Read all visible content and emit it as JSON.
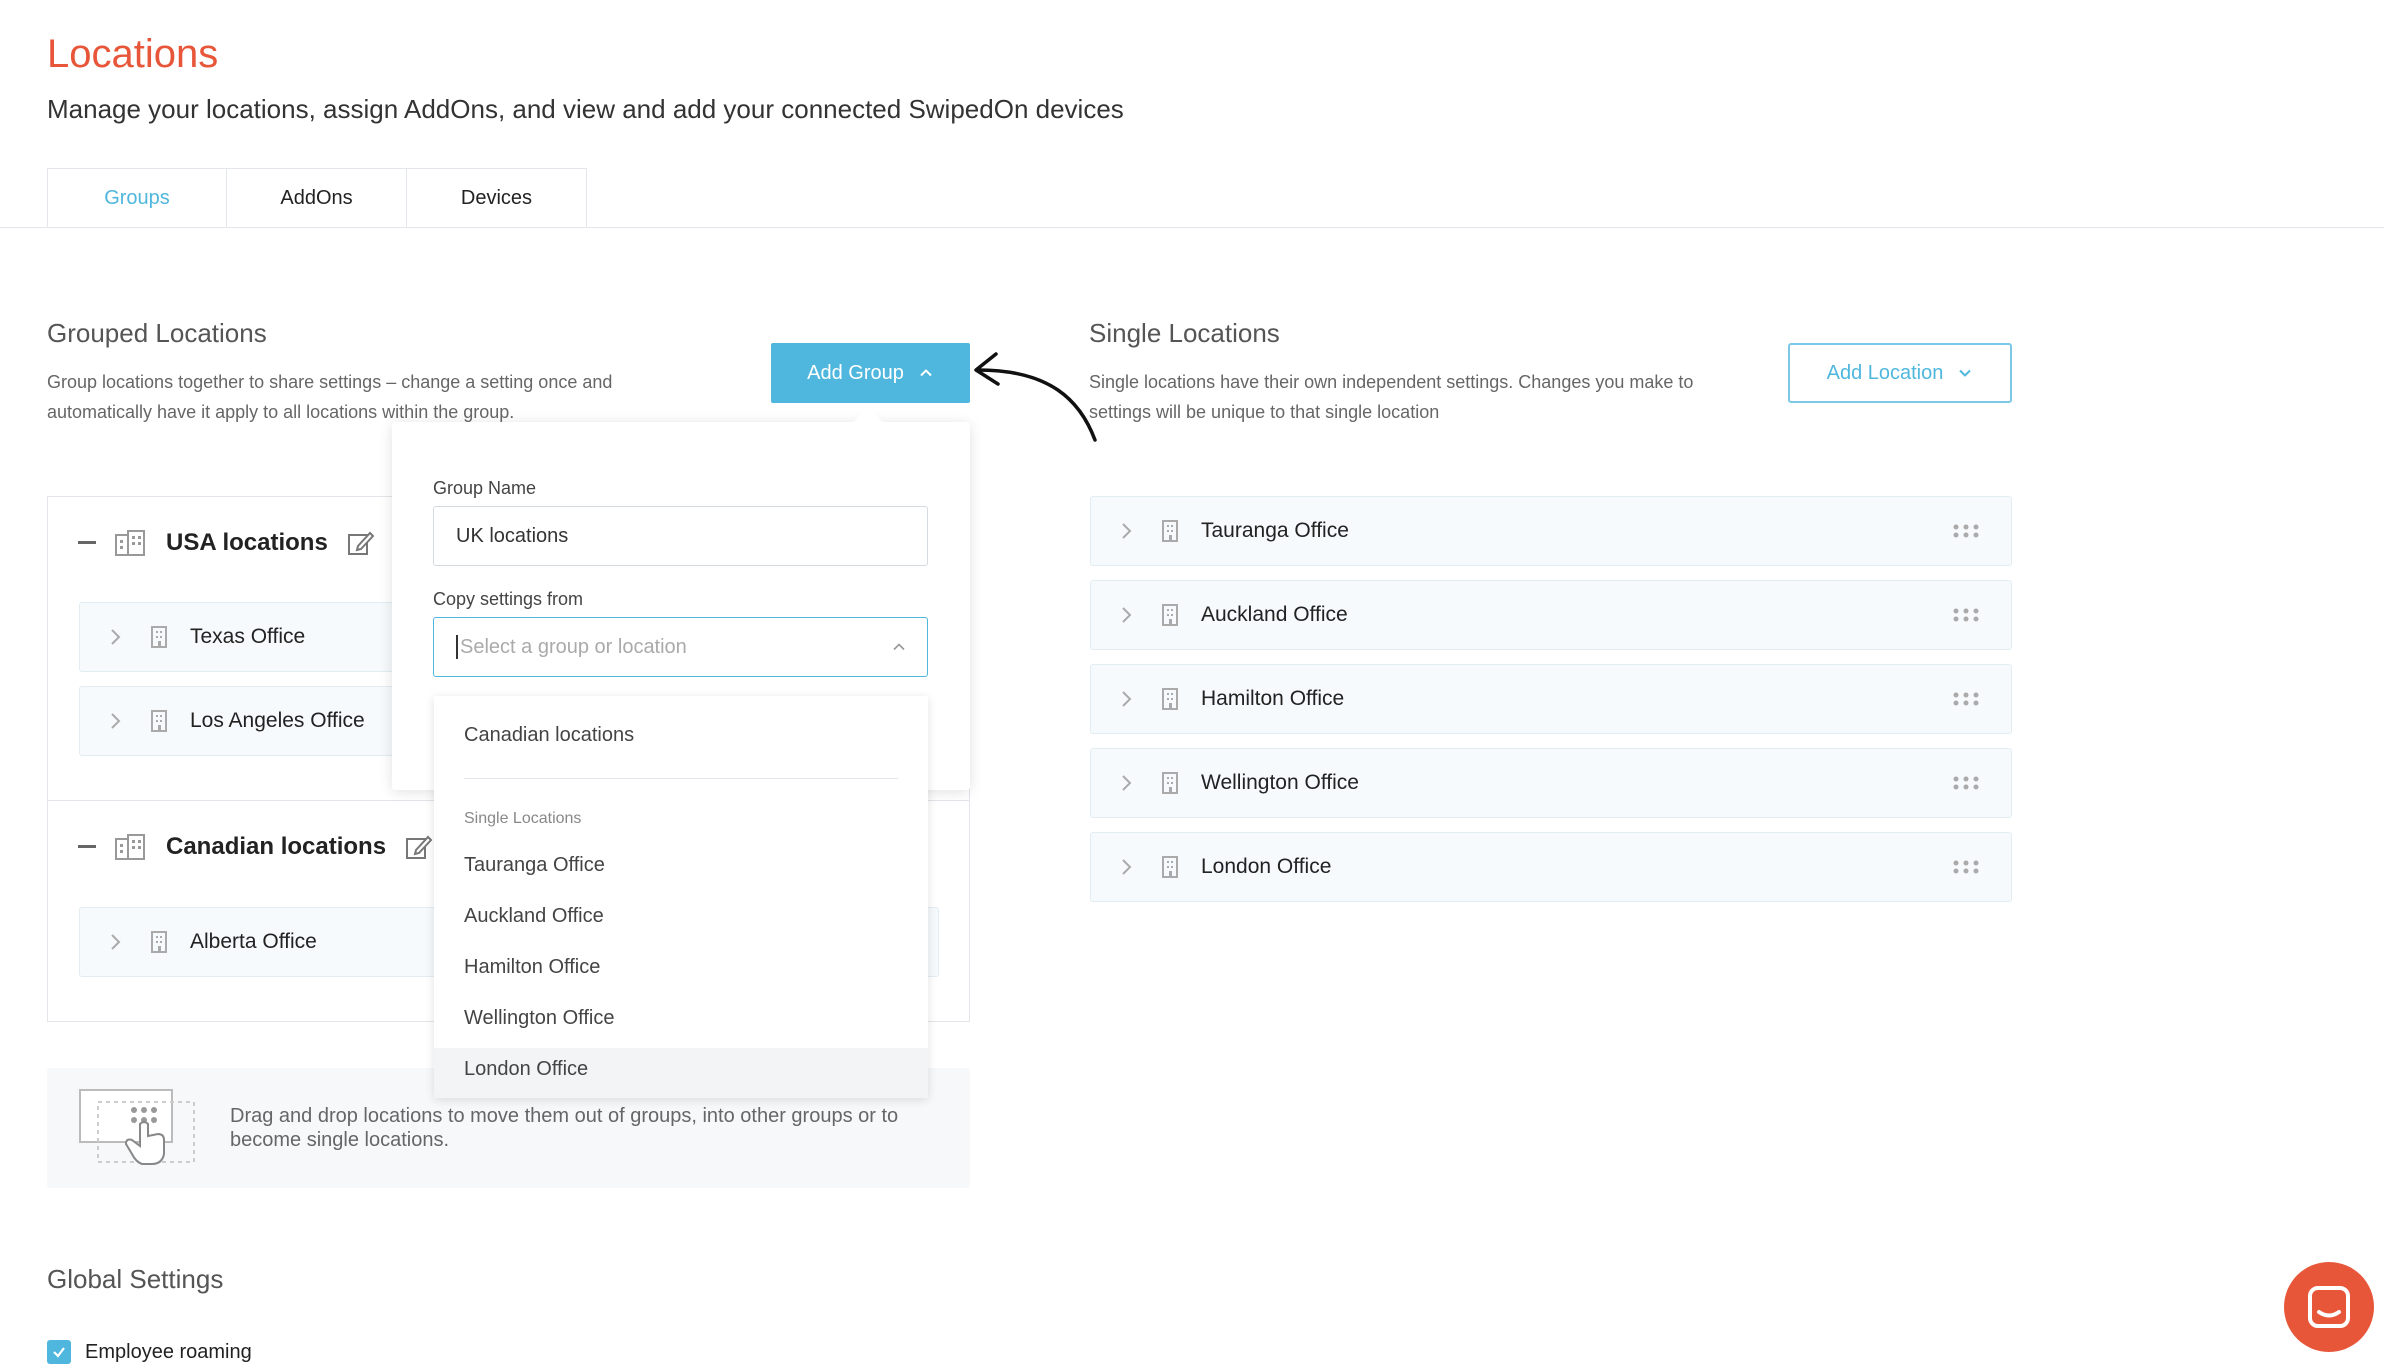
{
  "header": {
    "title": "Locations",
    "subtitle": "Manage your locations, assign AddOns, and view and add your connected SwipedOn devices"
  },
  "tabs": [
    {
      "label": "Groups",
      "active": true
    },
    {
      "label": "AddOns",
      "active": false
    },
    {
      "label": "Devices",
      "active": false
    }
  ],
  "grouped": {
    "title": "Grouped Locations",
    "desc_line1": "Group locations together to share settings – change a setting once and",
    "desc_line2": "automatically have it apply to all locations within the group.",
    "add_button": "Add Group",
    "groups": [
      {
        "name": "USA locations",
        "locations": [
          "Texas Office",
          "Los Angeles Office"
        ]
      },
      {
        "name": "Canadian locations",
        "locations": [
          "Alberta Office"
        ]
      }
    ],
    "info_text": "Drag and drop locations to move them out of groups, into other groups or to become single locations."
  },
  "single": {
    "title": "Single Locations",
    "desc_line1": "Single locations have their own independent settings. Changes you make to",
    "desc_line2": "settings will be unique to that single location",
    "add_button": "Add Location",
    "locations": [
      "Tauranga Office",
      "Auckland Office",
      "Hamilton Office",
      "Wellington Office",
      "London Office"
    ]
  },
  "popover": {
    "group_name_label": "Group Name",
    "group_name_value": "UK locations",
    "copy_label": "Copy settings from",
    "copy_placeholder": "Select a group or location",
    "dropdown": {
      "groups": [
        "Canadian locations"
      ],
      "single_header": "Single Locations",
      "singles": [
        "Tauranga Office",
        "Auckland Office",
        "Hamilton Office",
        "Wellington Office",
        "London Office"
      ],
      "highlighted": "London Office"
    }
  },
  "global": {
    "title": "Global Settings",
    "employee_roaming_label": "Employee roaming",
    "employee_roaming_checked": true
  },
  "colors": {
    "brand": "#e8563a",
    "accent": "#4fb7dd"
  }
}
